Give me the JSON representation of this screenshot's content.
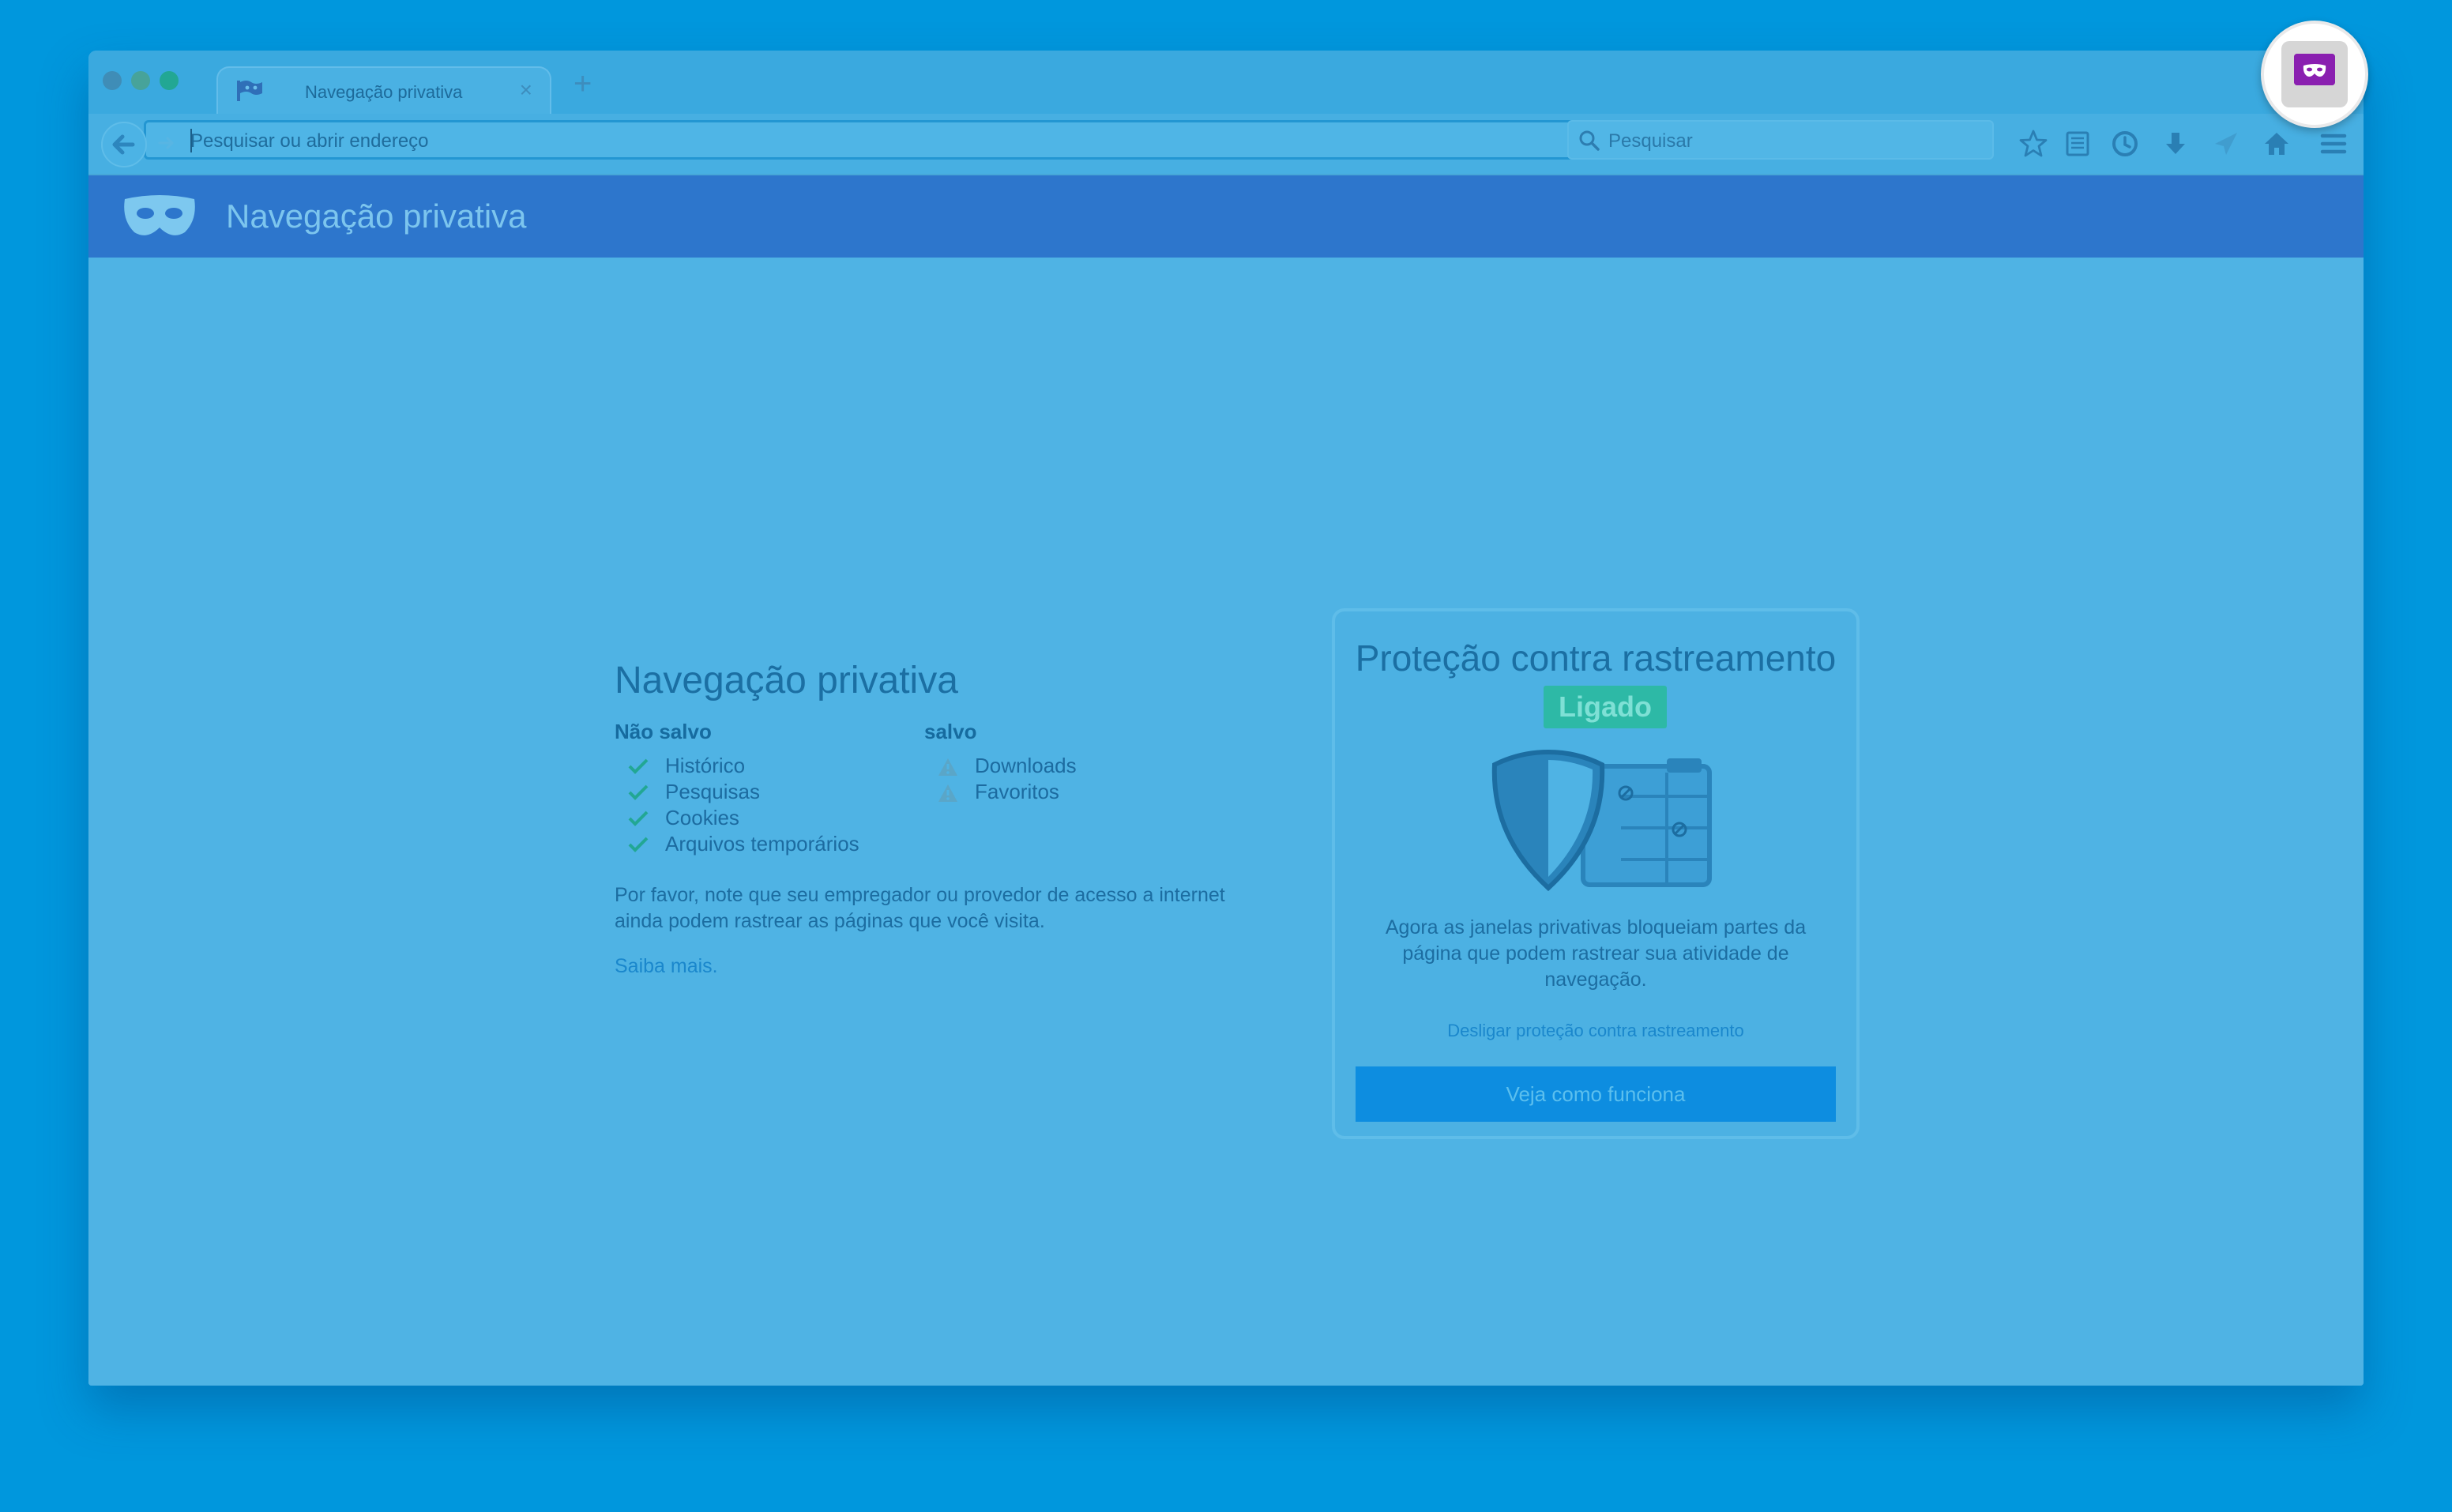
{
  "tab": {
    "title": "Navegação privativa",
    "close": "×",
    "new_tab": "+"
  },
  "navbar": {
    "url_placeholder": "Pesquisar ou abrir endereço",
    "search_placeholder": "Pesquisar"
  },
  "header": {
    "title": "Navegação privativa"
  },
  "left": {
    "title": "Navegação privativa",
    "not_saved_heading": "Não salvo",
    "not_saved_items": [
      "Histórico",
      "Pesquisas",
      "Cookies",
      "Arquivos temporários"
    ],
    "saved_heading": "salvo",
    "saved_items": [
      "Downloads",
      "Favoritos"
    ],
    "note": "Por favor, note que seu empregador ou provedor de acesso a internet ainda podem rastrear as páginas que você visita.",
    "learn_more": "Saiba mais."
  },
  "card": {
    "title": "Proteção contra rastreamento",
    "badge": "Ligado",
    "description": "Agora as janelas privativas bloqueiam partes da página que podem rastrear sua atividade de navegação.",
    "disable_link": "Desligar proteção contra rastreamento",
    "button": "Veja como funciona"
  },
  "colors": {
    "background": "#0097dd",
    "header": "#2d76cc",
    "content": "#4fb3e4",
    "badge": "#2db9a6",
    "button": "#0d8de0",
    "private_mask": "#8a1fb0"
  },
  "icons": [
    "back-arrow-icon",
    "forward-arrow-icon",
    "go-arrow-icon",
    "search-icon",
    "bookmark-star-icon",
    "reading-list-icon",
    "history-icon",
    "download-icon",
    "send-icon",
    "home-icon",
    "hamburger-menu-icon",
    "private-mask-icon",
    "check-icon",
    "warning-icon",
    "shield-icon"
  ]
}
